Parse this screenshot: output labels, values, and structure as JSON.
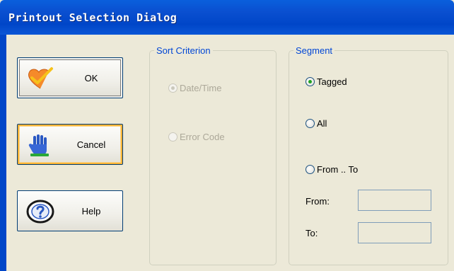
{
  "window": {
    "title": "Printout Selection Dialog"
  },
  "buttons": {
    "ok": {
      "label": "OK",
      "icon": "heart-check-icon"
    },
    "cancel": {
      "label": "Cancel",
      "icon": "hand-stop-icon"
    },
    "help": {
      "label": "Help",
      "icon": "help-question-icon"
    }
  },
  "sort_criterion": {
    "legend": "Sort Criterion",
    "options": [
      {
        "label": "Date/Time",
        "checked": true,
        "enabled": false
      },
      {
        "label": "Error Code",
        "checked": false,
        "enabled": false
      }
    ]
  },
  "segment": {
    "legend": "Segment",
    "options": [
      {
        "label": "Tagged",
        "checked": true
      },
      {
        "label": "All",
        "checked": false
      },
      {
        "label": "From .. To",
        "checked": false
      }
    ],
    "from_label": "From:",
    "from_value": "",
    "to_label": "To:",
    "to_value": ""
  },
  "colors": {
    "titlebar": "#0046c8",
    "legend_text": "#0046d5",
    "focus_ring": "#f8b336"
  }
}
